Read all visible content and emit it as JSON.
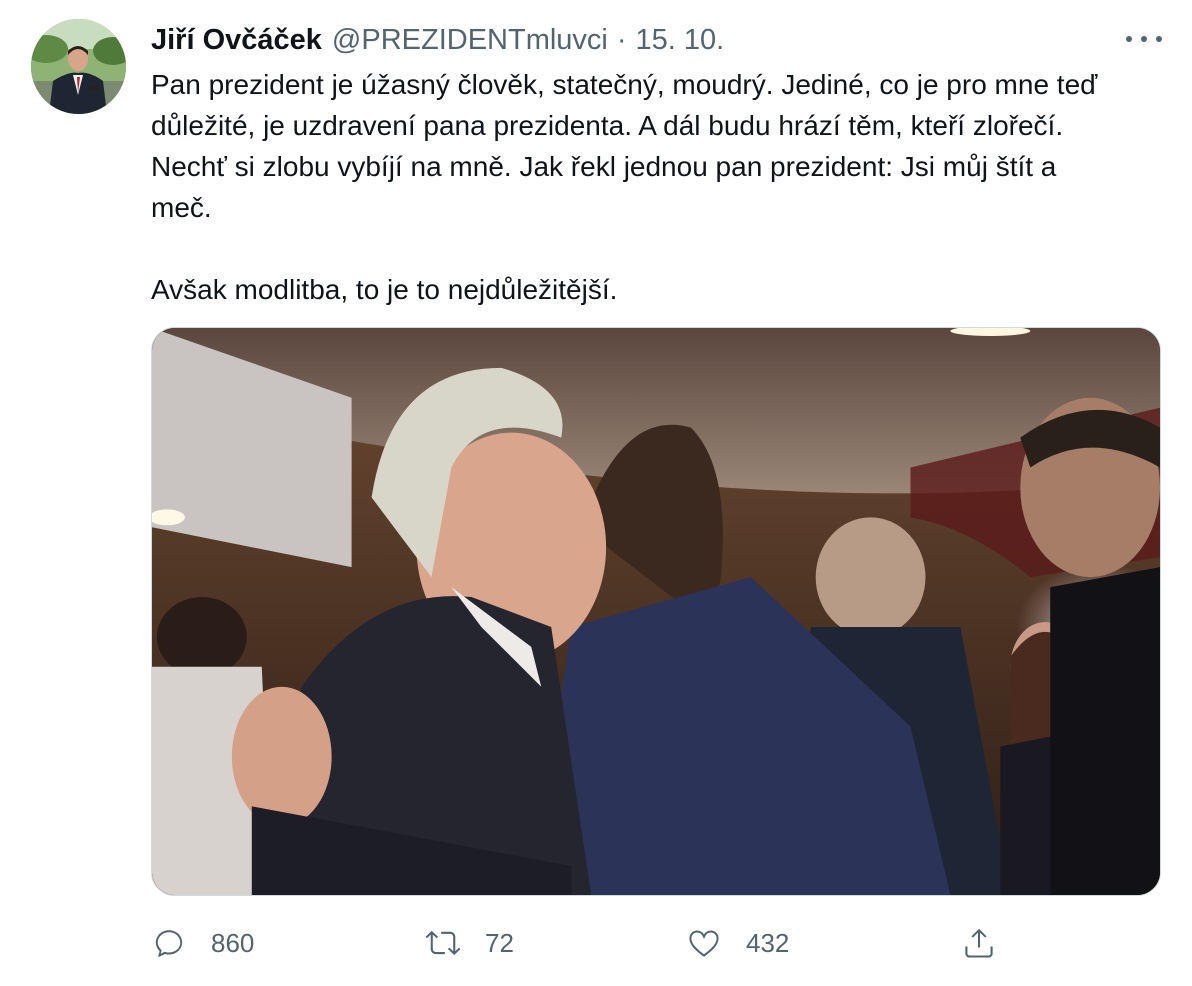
{
  "tweet": {
    "author": {
      "display_name": "Jiří Ovčáček",
      "handle": "@PREZIDENTmluvci",
      "separator": "·",
      "date": "15. 10."
    },
    "text_lines": [
      "Pan prezident je úžasný člověk, statečný, moudrý. Jediné, co je pro mne teď",
      "důležité, je uzdravení pana prezidenta. A dál budu hrází těm, kteří zlořečí.",
      "Nechť si zlobu vybíjí na mně. Jak řekl jednou pan prezident: Jsi můj štít a",
      "meč."
    ],
    "text_closing": "Avšak modlitba, to je to nejdůležitější.",
    "media": {
      "icon": "photo"
    },
    "actions": {
      "reply": {
        "icon": "reply-icon",
        "count": "860"
      },
      "retweet": {
        "icon": "retweet-icon",
        "count": "72"
      },
      "like": {
        "icon": "heart-icon",
        "count": "432"
      },
      "share": {
        "icon": "share-icon"
      }
    }
  },
  "colors": {
    "text_primary": "#0f1419",
    "text_secondary": "#536471",
    "border": "#cfd9de"
  }
}
